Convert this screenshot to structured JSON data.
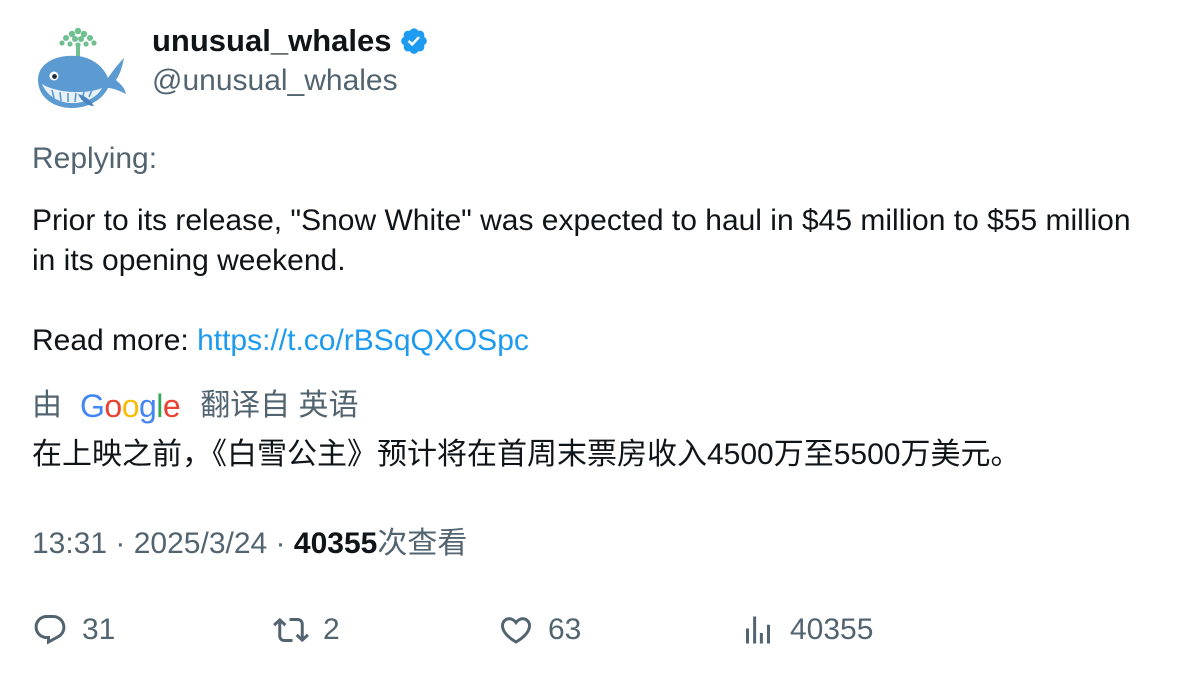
{
  "author": {
    "display_name": "unusual_whales",
    "handle": "@unusual_whales",
    "verified": true,
    "avatar_icon": "whale-avatar-icon"
  },
  "tweet": {
    "replying_label": "Replying:",
    "text": "Prior to its release, \"Snow White\" was expected to haul in $45 million to $55 million in its opening weekend.",
    "read_more_label": "Read more: ",
    "link_text": "https://t.co/rBSqQXOSpc"
  },
  "translation": {
    "by_label": "由",
    "provider": "Google",
    "from_label": "翻译自 英语",
    "text": "在上映之前，《白雪公主》预计将在首周末票房收入4500万至5500万美元。"
  },
  "meta": {
    "time": "13:31",
    "separator": " · ",
    "date": "2025/3/24",
    "views_count": "40355",
    "views_label": "次查看"
  },
  "actions": {
    "replies": "31",
    "retweets": "2",
    "likes": "63",
    "views": "40355"
  },
  "colors": {
    "link": "#1d9bf0",
    "secondary_text": "#536471",
    "primary_text": "#0f1419",
    "verified_badge": "#1d9bf0"
  }
}
